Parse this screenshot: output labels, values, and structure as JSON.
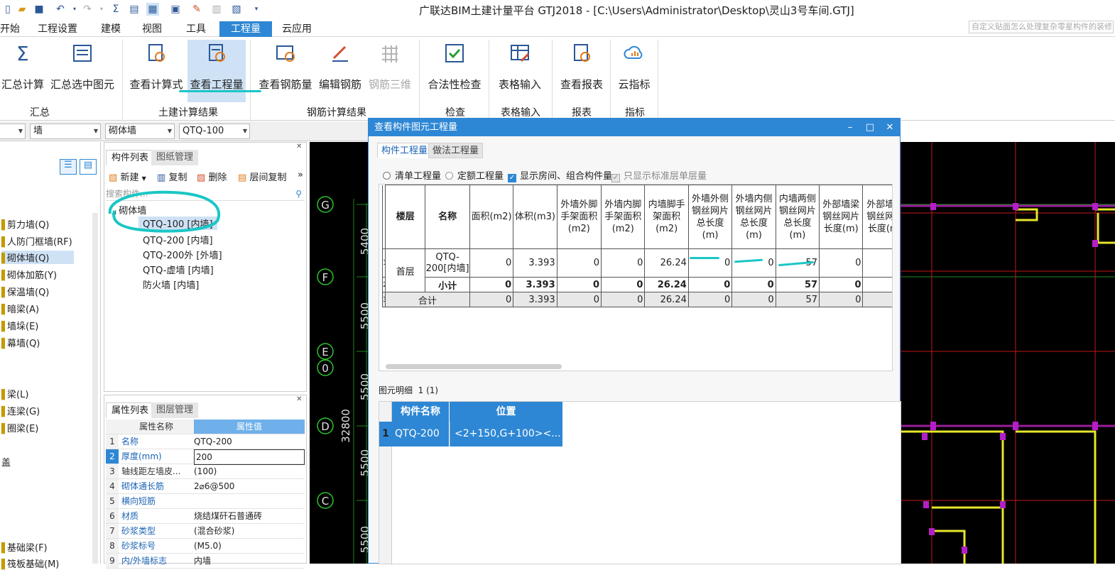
{
  "window": {
    "title": "广联达BIM土建计量平台 GTJ2018 - [C:\\Users\\Administrator\\Desktop\\灵山3号车间.GTJ]"
  },
  "menu": {
    "items": [
      "开始",
      "工程设置",
      "建模",
      "视图",
      "工具",
      "工程量",
      "云应用"
    ],
    "active": "工程量",
    "help_search_placeholder": "自定义贴面怎么处理复杂零星构件的装修"
  },
  "ribbon": {
    "buttons": [
      "汇总计算",
      "汇总选中图元",
      "查看计算式",
      "查看工程量",
      "查看钢筋量",
      "编辑钢筋",
      "钢筋三维",
      "合法性检查",
      "表格输入",
      "查看报表",
      "云指标"
    ],
    "groups": [
      "汇总",
      "土建计算结果",
      "钢筋计算结果",
      "检查",
      "表格输入",
      "报表",
      "指标"
    ]
  },
  "selectors": {
    "category": "墙",
    "type": "砌体墙",
    "component": "QTQ-100"
  },
  "left_modules": [
    "剪力墙(Q)",
    "人防门框墙(RF)",
    "砌体墙(Q)",
    "砌体加筋(Y)",
    "保温墙(Q)",
    "暗梁(A)",
    "墙垛(E)",
    "幕墙(Q)",
    "梁(L)",
    "连梁(G)",
    "圈梁(E)",
    "盖",
    "基础梁(F)",
    "筏板基础(M)"
  ],
  "component_panel": {
    "tabs": [
      "构件列表",
      "图纸管理"
    ],
    "toolbar": [
      "新建",
      "复制",
      "删除",
      "层间复制"
    ],
    "search_placeholder": "搜索构件...",
    "group": "砌体墙",
    "items": [
      "QTQ-100 [内墙]",
      "QTQ-200 [内墙]",
      "QTQ-200外 [外墙]",
      "QTQ-虚墙 [内墙]",
      "防火墙 [内墙]"
    ]
  },
  "property_panel": {
    "tabs": [
      "属性列表",
      "图层管理"
    ],
    "headers": [
      "属性名称",
      "属性值"
    ],
    "rows": [
      {
        "n": "1",
        "k": "名称",
        "v": "QTQ-200"
      },
      {
        "n": "2",
        "k": "厚度(mm)",
        "v": "200"
      },
      {
        "n": "3",
        "k": "轴线距左墙皮...",
        "v": "(100)"
      },
      {
        "n": "4",
        "k": "砌体通长筋",
        "v": "2⌀6@500"
      },
      {
        "n": "5",
        "k": "横向短筋",
        "v": ""
      },
      {
        "n": "6",
        "k": "材质",
        "v": "烧结煤矸石普通砖"
      },
      {
        "n": "7",
        "k": "砂浆类型",
        "v": "(混合砂浆)"
      },
      {
        "n": "8",
        "k": "砂浆标号",
        "v": "(M5.0)"
      },
      {
        "n": "9",
        "k": "内/外墙标志",
        "v": "内墙"
      }
    ]
  },
  "canvas": {
    "axes": [
      "G",
      "F",
      "E",
      "0",
      "D",
      "C"
    ],
    "dims": [
      "5400",
      "5500",
      "5500",
      "32800",
      "5500",
      "5500"
    ]
  },
  "dialog": {
    "title": "查看构件图元工程量",
    "tabs": [
      "构件工程量",
      "做法工程量"
    ],
    "options": {
      "list_qty": "清单工程量",
      "norm_qty": "定额工程量",
      "show_rooms": "显示房间、组合构件量",
      "std_floor_only": "只显示标准层单层量"
    },
    "table": {
      "headers": [
        "楼层",
        "名称",
        "面积(m2)",
        "体积(m3)",
        "外墙外脚手架面积(m2)",
        "外墙内脚手架面积(m2)",
        "内墙脚手架面积(m2)",
        "外墙外侧钢丝网片总长度(m)",
        "外墙内侧钢丝网片总长度(m)",
        "内墙两侧钢丝网片总长度(m)",
        "外部墙梁钢丝网片长度(m)",
        "外部墙柱钢丝网片长度(m)"
      ],
      "floor": "首层",
      "component": "QTQ-200[内墙]",
      "subtotal_label": "小计",
      "total_label": "合计",
      "rows": [
        {
          "idx": "1",
          "vals": [
            "0",
            "3.393",
            "0",
            "0",
            "26.24",
            "0",
            "0",
            "57",
            "0"
          ]
        },
        {
          "idx": "2",
          "vals": [
            "0",
            "3.393",
            "0",
            "0",
            "26.24",
            "0",
            "0",
            "57",
            "0"
          ]
        },
        {
          "idx": "3",
          "vals": [
            "0",
            "3.393",
            "0",
            "0",
            "26.24",
            "0",
            "0",
            "57",
            "0"
          ]
        }
      ]
    },
    "detail": {
      "label": "图元明细",
      "count": "1 (1)",
      "headers": [
        "构件名称",
        "位置"
      ],
      "row": {
        "idx": "1",
        "name": "QTQ-200",
        "position": "<2+150,G+100><..."
      }
    }
  },
  "colors": {
    "accent": "#2e87d4",
    "annotation": "#1bc6c6",
    "canvas_bg": "#000000"
  }
}
